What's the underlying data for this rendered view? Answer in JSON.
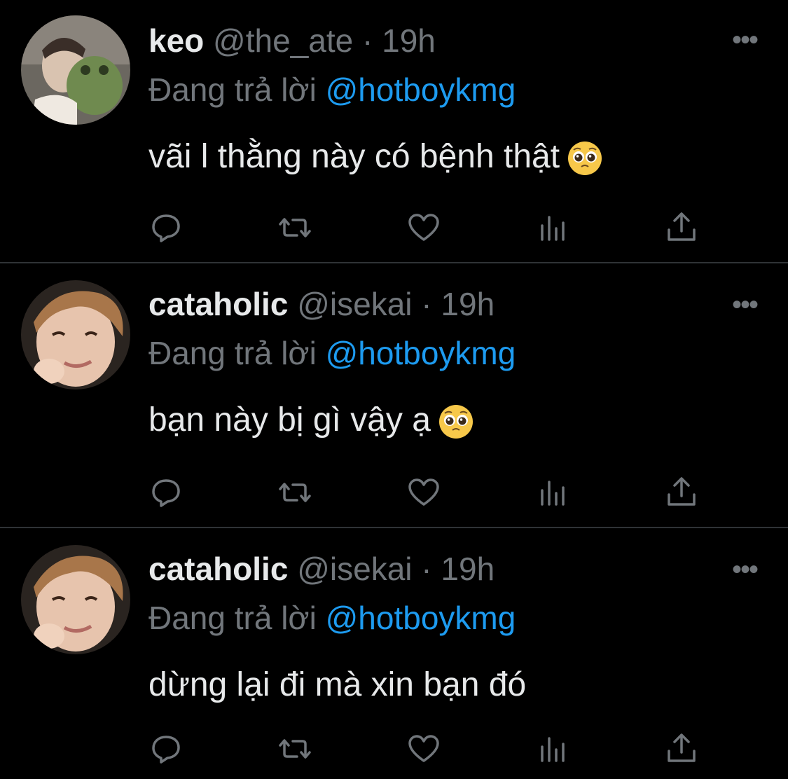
{
  "colors": {
    "background": "#000000",
    "name": "#e7e9ea",
    "meta": "#71767b",
    "mention": "#1d9bf0",
    "divider": "#2f3336"
  },
  "tweets": [
    {
      "display_name": "keo",
      "handle": "@the_ate",
      "separator": "·",
      "time": "19h",
      "replying_prefix": "Đang trả lời",
      "replying_to": "@hotboykmg",
      "text": "vãi l thằng này có bệnh thật",
      "emoji": "pleading-face",
      "more_icon": "ellipsis-icon",
      "actions": [
        "reply-icon",
        "retweet-icon",
        "like-icon",
        "analytics-icon",
        "share-icon"
      ]
    },
    {
      "display_name": "cataholic",
      "handle": "@isekai",
      "separator": "·",
      "time": "19h",
      "replying_prefix": "Đang trả lời",
      "replying_to": "@hotboykmg",
      "text": "bạn này bị gì vậy ạ",
      "emoji": "pleading-face",
      "more_icon": "ellipsis-icon",
      "actions": [
        "reply-icon",
        "retweet-icon",
        "like-icon",
        "analytics-icon",
        "share-icon"
      ]
    },
    {
      "display_name": "cataholic",
      "handle": "@isekai",
      "separator": "·",
      "time": "19h",
      "replying_prefix": "Đang trả lời",
      "replying_to": "@hotboykmg",
      "text": "dừng lại đi mà xin bạn đó",
      "more_icon": "ellipsis-icon",
      "actions": [
        "reply-icon",
        "retweet-icon",
        "like-icon",
        "analytics-icon",
        "share-icon"
      ]
    }
  ]
}
